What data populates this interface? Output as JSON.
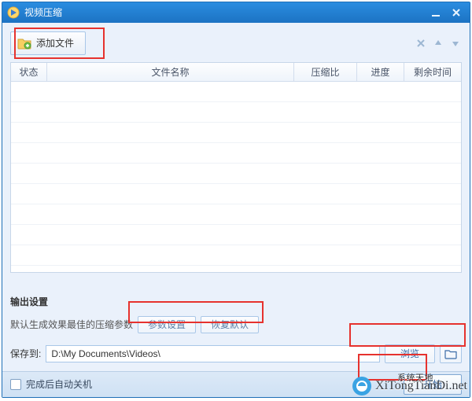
{
  "window": {
    "title": "视频压缩"
  },
  "toolbar": {
    "add_file_label": "添加文件"
  },
  "grid": {
    "columns": {
      "status": "状态",
      "name": "文件名称",
      "ratio": "压缩比",
      "progress": "进度",
      "time": "剩余时间"
    },
    "rows": []
  },
  "output": {
    "section_title": "输出设置",
    "param_desc": "默认生成效果最佳的压缩参数",
    "param_settings_label": "参数设置",
    "restore_default_label": "恢复默认",
    "save_to_label": "保存到:",
    "save_path": "D:\\My Documents\\Videos\\",
    "browse_label": "浏览"
  },
  "footer": {
    "shutdown_label": "完成后自动关机",
    "start_label": "开始"
  },
  "watermark": {
    "line1": "系统天地",
    "line2": "XiTongTianDi.net"
  }
}
